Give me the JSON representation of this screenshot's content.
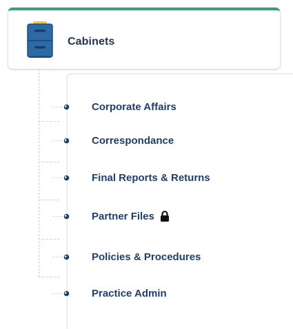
{
  "header": {
    "title": "Cabinets",
    "icon": "filing-cabinet-icon",
    "accent_color": "#3d9e6e"
  },
  "tree": {
    "items": [
      {
        "label": "Corporate Affairs",
        "locked": false
      },
      {
        "label": "Correspondance",
        "locked": false
      },
      {
        "label": "Final Reports & Returns",
        "locked": false
      },
      {
        "label": "Partner Files",
        "locked": true,
        "lock_icon": "lock-icon"
      },
      {
        "label": "Policies & Procedures",
        "locked": false
      },
      {
        "label": "Practice Admin",
        "locked": false
      }
    ],
    "label_color": "#1e3f6a",
    "bullet_icon": "bullet-icon"
  }
}
